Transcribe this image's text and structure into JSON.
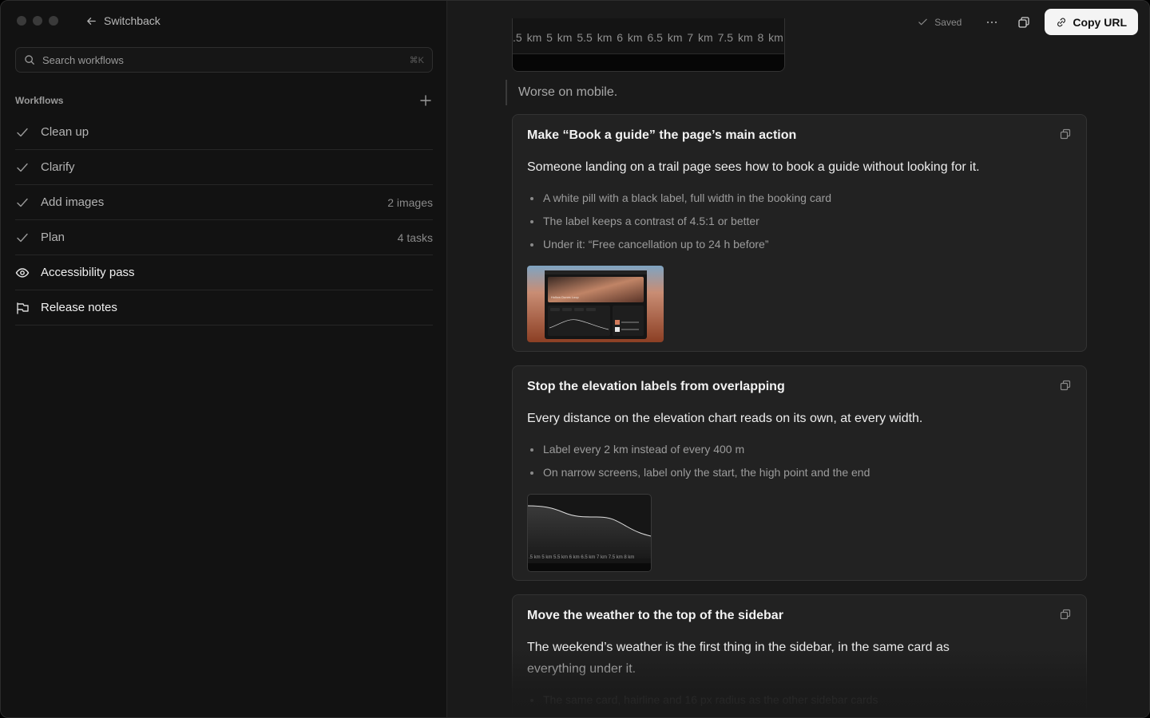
{
  "app": {
    "back_label": "Switchback"
  },
  "search": {
    "placeholder": "Search workflows",
    "shortcut": "⌘K"
  },
  "sidebar": {
    "section_title": "Workflows",
    "items": [
      {
        "label": "Clean up",
        "meta": "",
        "icon": "check-icon",
        "state": "done"
      },
      {
        "label": "Clarify",
        "meta": "",
        "icon": "check-icon",
        "state": "done"
      },
      {
        "label": "Add images",
        "meta": "2 images",
        "icon": "check-icon",
        "state": "done"
      },
      {
        "label": "Plan",
        "meta": "4 tasks",
        "icon": "check-icon",
        "state": "done"
      },
      {
        "label": "Accessibility pass",
        "meta": "",
        "icon": "eye-icon",
        "state": "active"
      },
      {
        "label": "Release notes",
        "meta": "",
        "icon": "megaphone-icon",
        "state": "pending"
      }
    ]
  },
  "toolbar": {
    "saved_label": "Saved",
    "more_icon": "more-horizontal-icon",
    "window_icon": "window-icon",
    "copy_label": "Copy URL"
  },
  "content": {
    "top_image_ticks": ".5 km  5 km  5.5 km  6 km  6.5 km  7 km  7.5 km  8 km",
    "quote": "Worse on mobile.",
    "cards": [
      {
        "title": "Make “Book a guide” the page’s main action",
        "lead": "Someone landing on a trail page sees how to book a guide without looking for it.",
        "bullets": [
          "A white pill with a black label, full width in the booking card",
          "The label keeps a contrast of 4.5:1 or better",
          "Under it: “Free cancellation up to 24 h before”"
        ],
        "thumb_caption": "Hollow Dunes Loop"
      },
      {
        "title": "Stop the elevation labels from overlapping",
        "lead": "Every distance on the elevation chart reads on its own, at every width.",
        "bullets": [
          "Label every 2 km instead of every 400 m",
          "On narrow screens, label only the start, the high point and the end"
        ],
        "thumb_ticks": ".5 km  5 km  5.5 km  6 km  6.5 km  7 km  7.5 km  8 km"
      },
      {
        "title": "Move the weather to the top of the sidebar",
        "lead": "The weekend’s weather is the first thing in the sidebar, in the same card as everything under it.",
        "bullets": [
          "The same card, hairline and 16 px radius as the other sidebar cards"
        ]
      }
    ]
  },
  "colors": {
    "sidebar_bg": "#121212",
    "main_bg": "#1a1a1a",
    "card_bg": "#222222",
    "button_bg": "#f4f4f4"
  }
}
